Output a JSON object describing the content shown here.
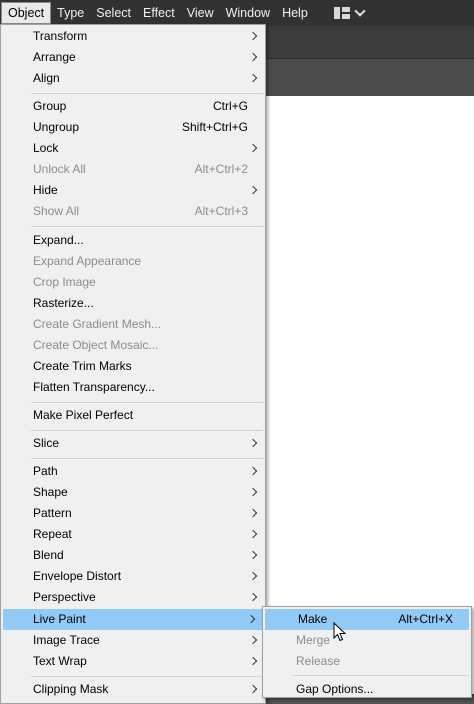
{
  "menubar": {
    "items": [
      "Object",
      "Type",
      "Select",
      "Effect",
      "View",
      "Window",
      "Help"
    ],
    "active": "Object",
    "workspace_icon": "workspace-layout-icon",
    "workspace_chevron": "chevron-down-icon"
  },
  "object_menu": {
    "items": [
      {
        "label": "Transform",
        "submenu": true
      },
      {
        "label": "Arrange",
        "submenu": true
      },
      {
        "label": "Align",
        "submenu": true
      },
      {
        "label": "Group",
        "shortcut": "Ctrl+G"
      },
      {
        "label": "Ungroup",
        "shortcut": "Shift+Ctrl+G"
      },
      {
        "label": "Lock",
        "submenu": true
      },
      {
        "label": "Unlock All",
        "shortcut": "Alt+Ctrl+2",
        "disabled": true
      },
      {
        "label": "Hide",
        "submenu": true
      },
      {
        "label": "Show All",
        "shortcut": "Alt+Ctrl+3",
        "disabled": true
      },
      {
        "label": "Expand..."
      },
      {
        "label": "Expand Appearance",
        "disabled": true
      },
      {
        "label": "Crop Image",
        "disabled": true
      },
      {
        "label": "Rasterize..."
      },
      {
        "label": "Create Gradient Mesh...",
        "disabled": true
      },
      {
        "label": "Create Object Mosaic...",
        "disabled": true
      },
      {
        "label": "Create Trim Marks"
      },
      {
        "label": "Flatten Transparency..."
      },
      {
        "label": "Make Pixel Perfect"
      },
      {
        "label": "Slice",
        "submenu": true
      },
      {
        "label": "Path",
        "submenu": true
      },
      {
        "label": "Shape",
        "submenu": true
      },
      {
        "label": "Pattern",
        "submenu": true
      },
      {
        "label": "Repeat",
        "submenu": true
      },
      {
        "label": "Blend",
        "submenu": true
      },
      {
        "label": "Envelope Distort",
        "submenu": true
      },
      {
        "label": "Perspective",
        "submenu": true
      },
      {
        "label": "Live Paint",
        "submenu": true,
        "highlighted": true
      },
      {
        "label": "Image Trace",
        "submenu": true
      },
      {
        "label": "Text Wrap",
        "submenu": true
      },
      {
        "label": "Clipping Mask",
        "submenu": true
      }
    ]
  },
  "live_paint_submenu": {
    "items": [
      {
        "label": "Make",
        "shortcut": "Alt+Ctrl+X",
        "highlighted": true
      },
      {
        "label": "Merge",
        "disabled": true
      },
      {
        "label": "Release",
        "disabled": true
      },
      {
        "label": "Gap Options..."
      }
    ]
  },
  "colors": {
    "highlight": "#91c9f7",
    "menu_bg": "#f0f0f0",
    "disabled_text": "#8c8c8c",
    "menubar_bg": "#323232"
  }
}
